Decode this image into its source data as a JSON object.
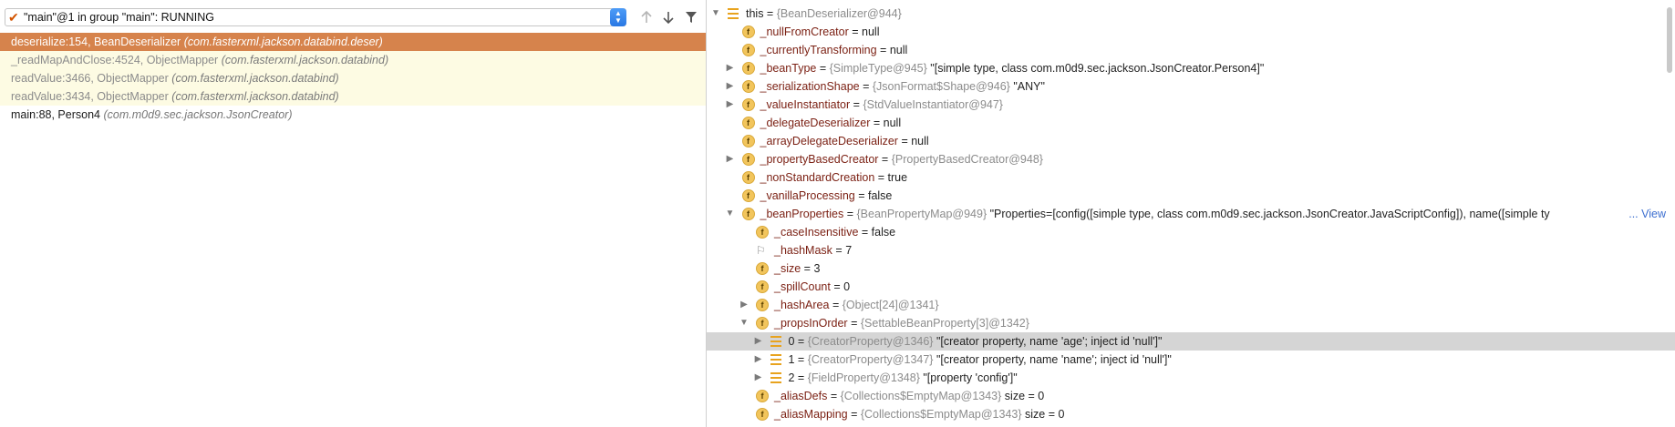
{
  "thread": {
    "label": "\"main\"@1 in group \"main\": RUNNING"
  },
  "icons": {
    "check": "check-icon",
    "up": "arrow-up-icon",
    "down": "arrow-down-icon",
    "filter": "filter-icon"
  },
  "frames": [
    {
      "method": "deserialize:154, BeanDeserializer",
      "pkg": "(com.fasterxml.jackson.databind.deser)",
      "state": "selected"
    },
    {
      "method": "_readMapAndClose:4524, ObjectMapper",
      "pkg": "(com.fasterxml.jackson.databind)",
      "state": "library"
    },
    {
      "method": "readValue:3466, ObjectMapper",
      "pkg": "(com.fasterxml.jackson.databind)",
      "state": "library"
    },
    {
      "method": "readValue:3434, ObjectMapper",
      "pkg": "(com.fasterxml.jackson.databind)",
      "state": "library"
    },
    {
      "method": "main:88, Person4",
      "pkg": "(com.m0d9.sec.jackson.JsonCreator)",
      "state": "normal"
    }
  ],
  "variables": [
    {
      "level": 0,
      "toggle": "down",
      "icon": "list",
      "name": "this",
      "eq": " = ",
      "type": "{BeanDeserializer@944}",
      "value": "",
      "plain": true
    },
    {
      "level": 1,
      "toggle": "",
      "icon": "f",
      "name": "_nullFromCreator",
      "eq": " = ",
      "type": "",
      "value": "null"
    },
    {
      "level": 1,
      "toggle": "",
      "icon": "f",
      "name": "_currentlyTransforming",
      "eq": " = ",
      "type": "",
      "value": "null"
    },
    {
      "level": 1,
      "toggle": "right",
      "icon": "f",
      "name": "_beanType",
      "eq": " = ",
      "type": "{SimpleType@945}",
      "value": " \"[simple type, class com.m0d9.sec.jackson.JsonCreator.Person4]\""
    },
    {
      "level": 1,
      "toggle": "right",
      "icon": "f",
      "name": "_serializationShape",
      "eq": " = ",
      "type": "{JsonFormat$Shape@946}",
      "value": " \"ANY\""
    },
    {
      "level": 1,
      "toggle": "right",
      "icon": "f",
      "name": "_valueInstantiator",
      "eq": " = ",
      "type": "{StdValueInstantiator@947}",
      "value": ""
    },
    {
      "level": 1,
      "toggle": "",
      "icon": "f",
      "name": "_delegateDeserializer",
      "eq": " = ",
      "type": "",
      "value": "null"
    },
    {
      "level": 1,
      "toggle": "",
      "icon": "f",
      "name": "_arrayDelegateDeserializer",
      "eq": " = ",
      "type": "",
      "value": "null"
    },
    {
      "level": 1,
      "toggle": "right",
      "icon": "f",
      "name": "_propertyBasedCreator",
      "eq": " = ",
      "type": "{PropertyBasedCreator@948}",
      "value": ""
    },
    {
      "level": 1,
      "toggle": "",
      "icon": "f",
      "name": "_nonStandardCreation",
      "eq": " = ",
      "type": "",
      "value": "true"
    },
    {
      "level": 1,
      "toggle": "",
      "icon": "f",
      "name": "_vanillaProcessing",
      "eq": " = ",
      "type": "",
      "value": "false"
    },
    {
      "level": 1,
      "toggle": "down",
      "icon": "f",
      "name": "_beanProperties",
      "eq": " = ",
      "type": "{BeanPropertyMap@949}",
      "value": " \"Properties=[config([simple type, class com.m0d9.sec.jackson.JsonCreator.JavaScriptConfig]), name([simple ty",
      "link": "... View"
    },
    {
      "level": 2,
      "toggle": "",
      "icon": "f",
      "name": "_caseInsensitive",
      "eq": " = ",
      "type": "",
      "value": "false"
    },
    {
      "level": 2,
      "toggle": "",
      "icon": "flag",
      "name": "_hashMask",
      "eq": " = ",
      "type": "",
      "value": "7"
    },
    {
      "level": 2,
      "toggle": "",
      "icon": "f",
      "name": "_size",
      "eq": " = ",
      "type": "",
      "value": "3"
    },
    {
      "level": 2,
      "toggle": "",
      "icon": "f",
      "name": "_spillCount",
      "eq": " = ",
      "type": "",
      "value": "0"
    },
    {
      "level": 2,
      "toggle": "right",
      "icon": "f",
      "name": "_hashArea",
      "eq": " = ",
      "type": "{Object[24]@1341}",
      "value": ""
    },
    {
      "level": 2,
      "toggle": "down",
      "icon": "f",
      "name": "_propsInOrder",
      "eq": " = ",
      "type": "{SettableBeanProperty[3]@1342}",
      "value": ""
    },
    {
      "level": 3,
      "toggle": "right",
      "icon": "list",
      "name": "0",
      "eq": " = ",
      "type": "{CreatorProperty@1346}",
      "value": " \"[creator property, name 'age'; inject id 'null']\"",
      "plain": true,
      "selected": true
    },
    {
      "level": 3,
      "toggle": "right",
      "icon": "list",
      "name": "1",
      "eq": " = ",
      "type": "{CreatorProperty@1347}",
      "value": " \"[creator property, name 'name'; inject id 'null']\"",
      "plain": true
    },
    {
      "level": 3,
      "toggle": "right",
      "icon": "list",
      "name": "2",
      "eq": " = ",
      "type": "{FieldProperty@1348}",
      "value": " \"[property 'config']\"",
      "plain": true
    },
    {
      "level": 2,
      "toggle": "",
      "icon": "f",
      "name": "_aliasDefs",
      "eq": " = ",
      "type": "{Collections$EmptyMap@1343}",
      "value": "  size = 0"
    },
    {
      "level": 2,
      "toggle": "",
      "icon": "f",
      "name": "_aliasMapping",
      "eq": " = ",
      "type": "{Collections$EmptyMap@1343}",
      "value": "  size = 0"
    }
  ]
}
